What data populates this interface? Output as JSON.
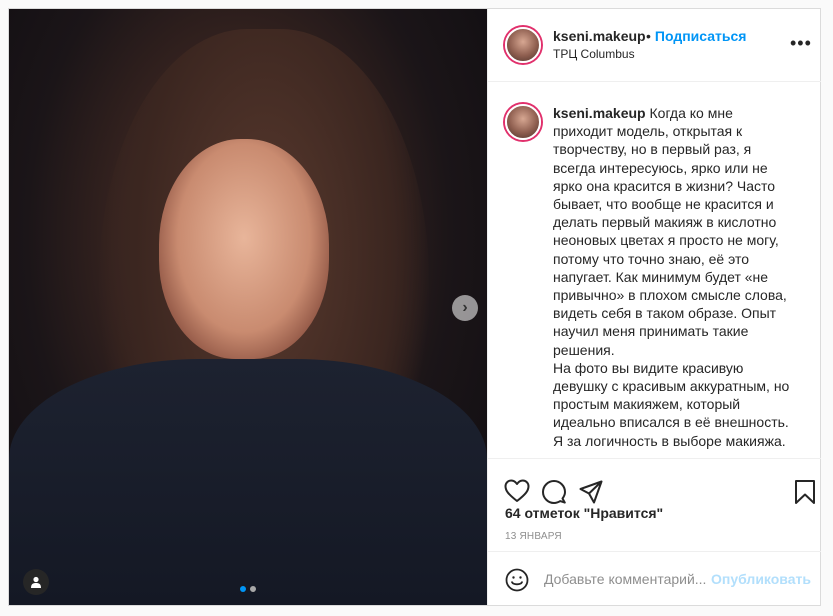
{
  "post": {
    "username": "kseni.makeup",
    "follow_label": "Подписаться",
    "separator": "•",
    "location": "ТРЦ Columbus",
    "more_label": "•••",
    "next_arrow": "›",
    "carousel": {
      "count": 2,
      "active_index": 0
    }
  },
  "caption": {
    "username": "kseni.makeup",
    "lines": [
      "Когда ко мне",
      "приходит модель, открытая к",
      "творчеству, но в первый раз, я",
      "всегда интересуюсь, ярко или не",
      "ярко она красится в жизни? Часто",
      "бывает, что вообще не красится и",
      "делать первый макияж в кислотно",
      "неоновых цветах я просто не могу,",
      "потому что точно знаю, её это",
      "напугает. Как минимум будет «не",
      "привычно» в плохом смысле слова,",
      "видеть себя в таком образе. Опыт",
      "научил меня принимать такие",
      "решения.",
      "На фото вы видите красивую",
      "девушку с красивым аккуратным, но",
      "простым макияжем, который",
      "идеально вписался в её внешность.",
      "Я за логичность в выборе макияжа."
    ]
  },
  "actions": {
    "icons": [
      "heart-icon",
      "comment-icon",
      "share-icon",
      "bookmark-icon"
    ],
    "likes_text": "64 отметок \"Нравится\"",
    "date": "13 ЯНВАРЯ"
  },
  "comment": {
    "placeholder": "Добавьте комментарий...",
    "post_label": "Опубликовать"
  },
  "colors": {
    "accent": "#0095f6",
    "post_disabled": "#b2dffc",
    "text": "#262626",
    "muted": "#8e8e8e"
  }
}
